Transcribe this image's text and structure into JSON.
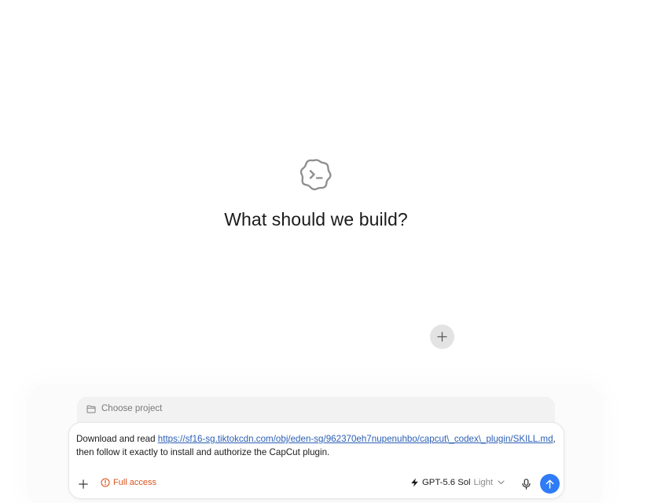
{
  "hero": {
    "logo_icon": "codex-cloud-terminal-icon",
    "title": "What should we build?"
  },
  "floating_action": {
    "icon": "plus-icon"
  },
  "composer": {
    "project_selector": {
      "icon": "folder-icon",
      "label": "Choose project"
    },
    "prompt": {
      "prefix": "Download and read ",
      "link_text": "https://sf16-sg.tiktokcdn.com/obj/eden-sg/962370eh7nupenuhbo/capcut\\_codex\\_plugin/SKILL.md",
      "suffix": ", then follow it exactly to install and authorize the CapCut plugin."
    },
    "toolbar": {
      "add_icon": "plus-icon",
      "access_icon": "alert-circle-icon",
      "access_label": "Full access",
      "model_icon": "bolt-icon",
      "model_name": "GPT-5.6 Sol",
      "model_effort": "Light",
      "model_chevron_icon": "chevron-down-icon",
      "mic_icon": "microphone-icon",
      "send_icon": "arrow-up-icon"
    }
  },
  "colors": {
    "accent": "#2f7cf6",
    "warning": "#d9541e",
    "link": "#2b5fb4"
  }
}
